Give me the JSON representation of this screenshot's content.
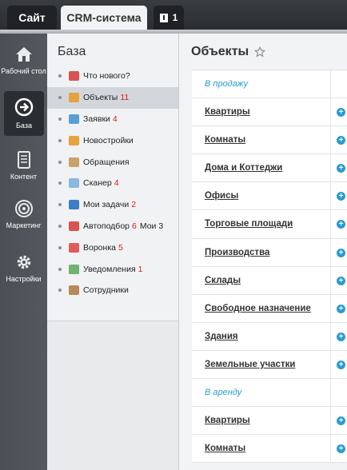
{
  "topbar": {
    "tabs": [
      {
        "label": "Сайт"
      },
      {
        "label": "CRM-система"
      }
    ],
    "notifications": {
      "count": "1"
    }
  },
  "rail": {
    "items": [
      {
        "label": "Рабочий стол",
        "icon": "home-icon"
      },
      {
        "label": "База",
        "icon": "arrow-circle-icon"
      },
      {
        "label": "Контент",
        "icon": "document-icon"
      },
      {
        "label": "Маркетинг",
        "icon": "target-icon"
      },
      {
        "label": "Настройки",
        "icon": "gear-icon"
      }
    ]
  },
  "sidebar": {
    "title": "База",
    "items": [
      {
        "label": "Что нового?",
        "count": "",
        "extra": "",
        "color": "#d9534f"
      },
      {
        "label": "Объекты",
        "count": "11",
        "extra": "",
        "color": "#e6a23c"
      },
      {
        "label": "Заявки",
        "count": "4",
        "extra": "",
        "color": "#5aa0d8"
      },
      {
        "label": "Новостройки",
        "count": "",
        "extra": "",
        "color": "#e6a23c"
      },
      {
        "label": "Обращения",
        "count": "",
        "extra": "",
        "color": "#c8a26a"
      },
      {
        "label": "Сканер",
        "count": "4",
        "extra": "",
        "color": "#8ab8e0"
      },
      {
        "label": "Мои задачи",
        "count": "2",
        "extra": "",
        "color": "#3a7fc4"
      },
      {
        "label": "Автоподбор",
        "count": "6",
        "extra": "Мои 3",
        "color": "#d9534f"
      },
      {
        "label": "Воронка",
        "count": "5",
        "extra": "",
        "color": "#e05a5a"
      },
      {
        "label": "Уведомления",
        "count": "1",
        "extra": "",
        "color": "#6fb36f"
      },
      {
        "label": "Сотрудники",
        "count": "",
        "extra": "",
        "color": "#b88a5a"
      }
    ]
  },
  "main": {
    "title": "Объекты",
    "rows": [
      {
        "label": "В продажу",
        "section": true
      },
      {
        "label": "Квартиры"
      },
      {
        "label": "Комнаты"
      },
      {
        "label": "Дома и Коттеджи"
      },
      {
        "label": "Офисы"
      },
      {
        "label": "Торговые площади"
      },
      {
        "label": "Производства"
      },
      {
        "label": "Склады"
      },
      {
        "label": "Свободное назначение"
      },
      {
        "label": "Здания"
      },
      {
        "label": "Земельные участки"
      },
      {
        "label": "В аренду",
        "section": true
      },
      {
        "label": "Квартиры"
      },
      {
        "label": "Комнаты"
      }
    ]
  },
  "colors": {
    "accent": "#2a9bd4",
    "count": "#d41f1f"
  }
}
